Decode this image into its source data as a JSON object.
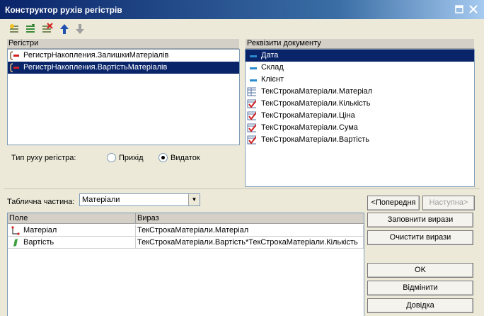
{
  "window": {
    "title": "Конструктор рухів регістрів"
  },
  "registers": {
    "header": "Регістри",
    "items": [
      {
        "label": "РегистрНакопления.ЗалишкиМатеріалів",
        "selected": false
      },
      {
        "label": "РегистрНакопления.ВартістьМатеріалів",
        "selected": true
      }
    ]
  },
  "requisites": {
    "header": "Реквізити документу",
    "items": [
      {
        "label": "Дата",
        "icon": "field-icon",
        "selected": true
      },
      {
        "label": "Склад",
        "icon": "field-icon",
        "selected": false
      },
      {
        "label": "Клієнт",
        "icon": "field-icon",
        "selected": false
      },
      {
        "label": "ТекСтрокаМатеріали.Матеріал",
        "icon": "table-field-icon",
        "selected": false
      },
      {
        "label": "ТекСтрокаМатеріали.Кількість",
        "icon": "table-checked-icon",
        "selected": false
      },
      {
        "label": "ТекСтрокаМатеріали.Ціна",
        "icon": "table-checked-icon",
        "selected": false
      },
      {
        "label": "ТекСтрокаМатеріали.Сума",
        "icon": "table-checked-icon",
        "selected": false
      },
      {
        "label": "ТекСтрокаМатеріали.Вартість",
        "icon": "table-checked-icon",
        "selected": false
      }
    ]
  },
  "movement_type": {
    "label": "Тип руху регістра:",
    "options": [
      {
        "label": "Прихід",
        "checked": false
      },
      {
        "label": "Видаток",
        "checked": true
      }
    ]
  },
  "table_part": {
    "label": "Таблична частина:",
    "value": "Матеріали"
  },
  "nav": {
    "prev": "<Попередня",
    "next": "Наступна>"
  },
  "grid": {
    "columns": [
      "Поле",
      "Вираз"
    ],
    "rows": [
      {
        "field": "Матеріал",
        "expr": "ТекСтрокаМатеріали.Матеріал",
        "icon": "dimension-icon"
      },
      {
        "field": "Вартість",
        "expr": "ТекСтрокаМатеріали.Вартість*ТекСтрокаМатеріали.Кількість",
        "icon": "resource-icon"
      }
    ]
  },
  "buttons": {
    "fill": "Заповнити вирази",
    "clear": "Очистити вирази",
    "ok": "OK",
    "cancel": "Відмінити",
    "help": "Довідка"
  },
  "colors": {
    "title_start": "#0a246a",
    "title_end": "#a6caf0",
    "selection": "#0a246a",
    "face": "#ece9d8"
  }
}
